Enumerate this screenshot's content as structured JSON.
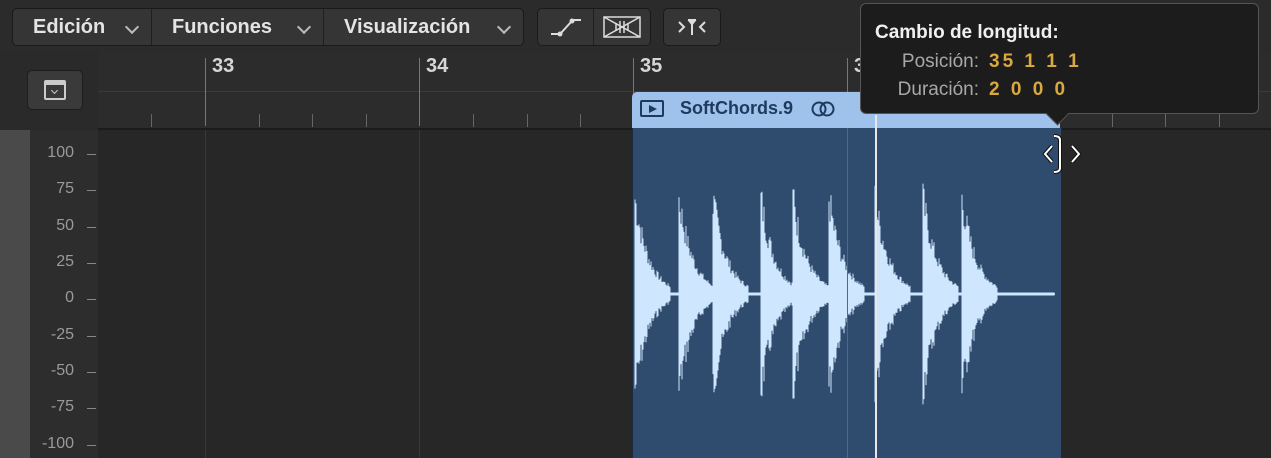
{
  "toolbar": {
    "menus": [
      {
        "label": "Edición"
      },
      {
        "label": "Funciones"
      },
      {
        "label": "Visualización"
      }
    ],
    "buttons": [
      "automation-curve-icon",
      "crossfade-icon",
      "zoom-to-fit-icon"
    ]
  },
  "ruler": {
    "bars": [
      "33",
      "34",
      "35",
      "3"
    ]
  },
  "scale": {
    "labels": [
      "100",
      "75",
      "50",
      "25",
      "0",
      "-25",
      "-50",
      "-75",
      "-100"
    ]
  },
  "region": {
    "name": "SoftChords.9",
    "color": "#9ec2ec",
    "body_color": "#2f4b6e",
    "waveform_color": "#cfe6ff"
  },
  "tooltip": {
    "title": "Cambio de longitud:",
    "position_label": "Posición:",
    "position_value": "35 1 1 1",
    "duration_label": "Duración:",
    "duration_value": "2 0 0 0",
    "value_color": "#d9a83e"
  }
}
